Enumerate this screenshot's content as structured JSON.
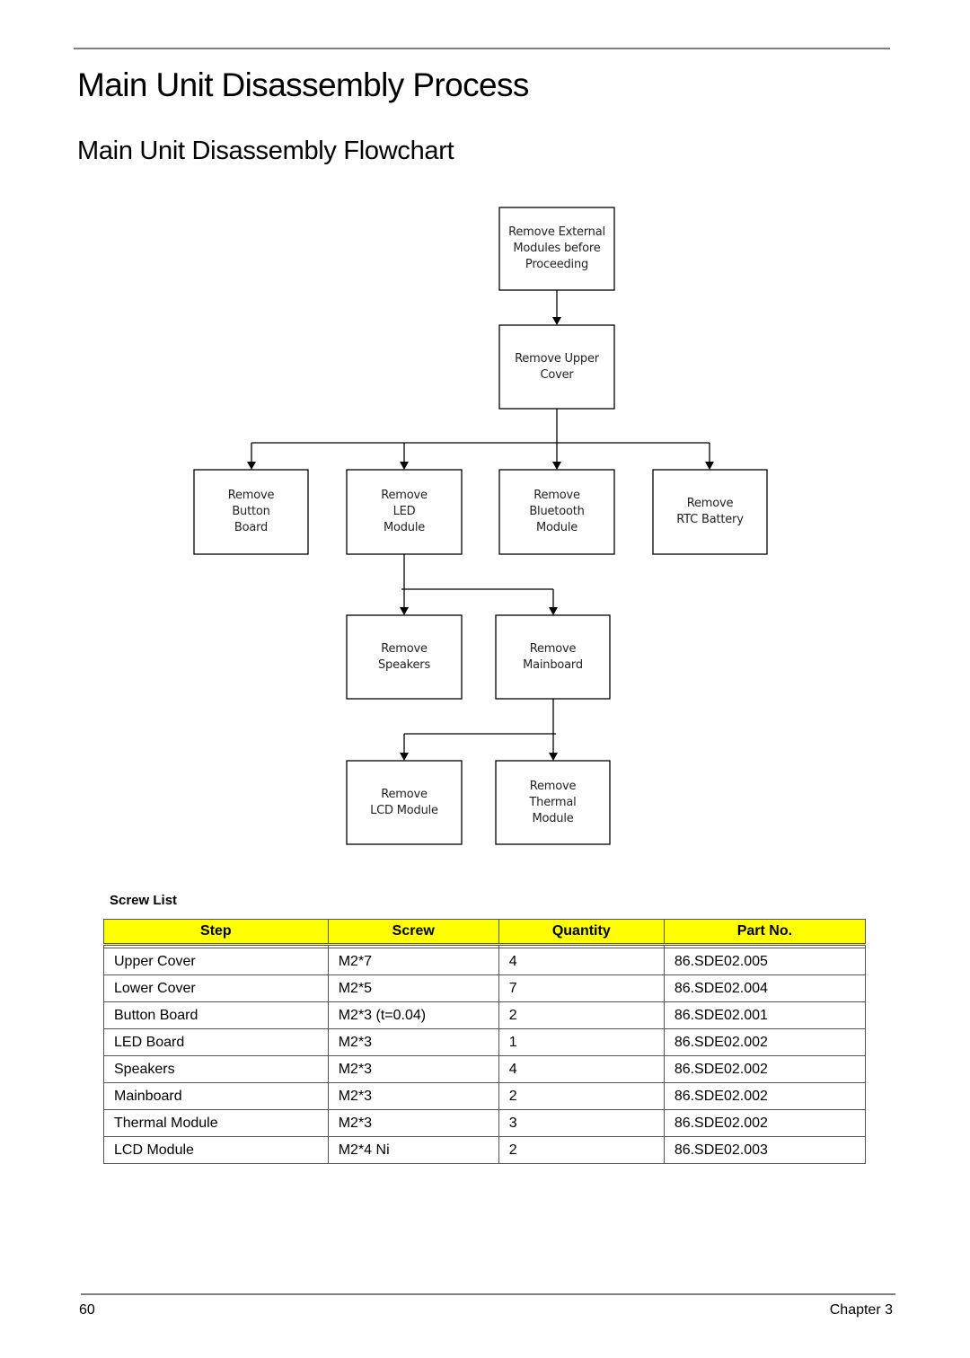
{
  "header": {
    "title": "Main Unit Disassembly Process",
    "subtitle": "Main Unit Disassembly Flowchart"
  },
  "flowchart": {
    "nodes": {
      "external": "Remove External\nModules before\nProceeding",
      "upper_cover": "Remove Upper\nCover",
      "button_board": "Remove\nButton\nBoard",
      "led_module": "Remove\nLED\nModule",
      "bluetooth": "Remove\nBluetooth\nModule",
      "rtc_battery": "Remove\nRTC Battery",
      "speakers": "Remove\nSpeakers",
      "mainboard": "Remove\nMainboard",
      "lcd_module": "Remove\nLCD Module",
      "thermal": "Remove\nThermal\nModule"
    },
    "edges": [
      [
        "external",
        "upper_cover"
      ],
      [
        "upper_cover",
        "button_board"
      ],
      [
        "upper_cover",
        "led_module"
      ],
      [
        "upper_cover",
        "bluetooth"
      ],
      [
        "upper_cover",
        "rtc_battery"
      ],
      [
        "led_module",
        "speakers"
      ],
      [
        "led_module",
        "mainboard"
      ],
      [
        "mainboard",
        "lcd_module"
      ],
      [
        "mainboard",
        "thermal"
      ]
    ]
  },
  "screw_list": {
    "caption": "Screw List",
    "header_color": "#ffff00",
    "columns": [
      "Step",
      "Screw",
      "Quantity",
      "Part No."
    ],
    "rows": [
      [
        "Upper Cover",
        "M2*7",
        "4",
        "86.SDE02.005"
      ],
      [
        "Lower Cover",
        "M2*5",
        "7",
        "86.SDE02.004"
      ],
      [
        "Button Board",
        "M2*3 (t=0.04)",
        "2",
        "86.SDE02.001"
      ],
      [
        "LED Board",
        "M2*3",
        "1",
        "86.SDE02.002"
      ],
      [
        "Speakers",
        "M2*3",
        "4",
        "86.SDE02.002"
      ],
      [
        "Mainboard",
        "M2*3",
        "2",
        "86.SDE02.002"
      ],
      [
        "Thermal Module",
        "M2*3",
        "3",
        "86.SDE02.002"
      ],
      [
        "LCD Module",
        "M2*4 Ni",
        "2",
        "86.SDE02.003"
      ]
    ]
  },
  "footer": {
    "page_number": "60",
    "chapter": "Chapter 3"
  }
}
